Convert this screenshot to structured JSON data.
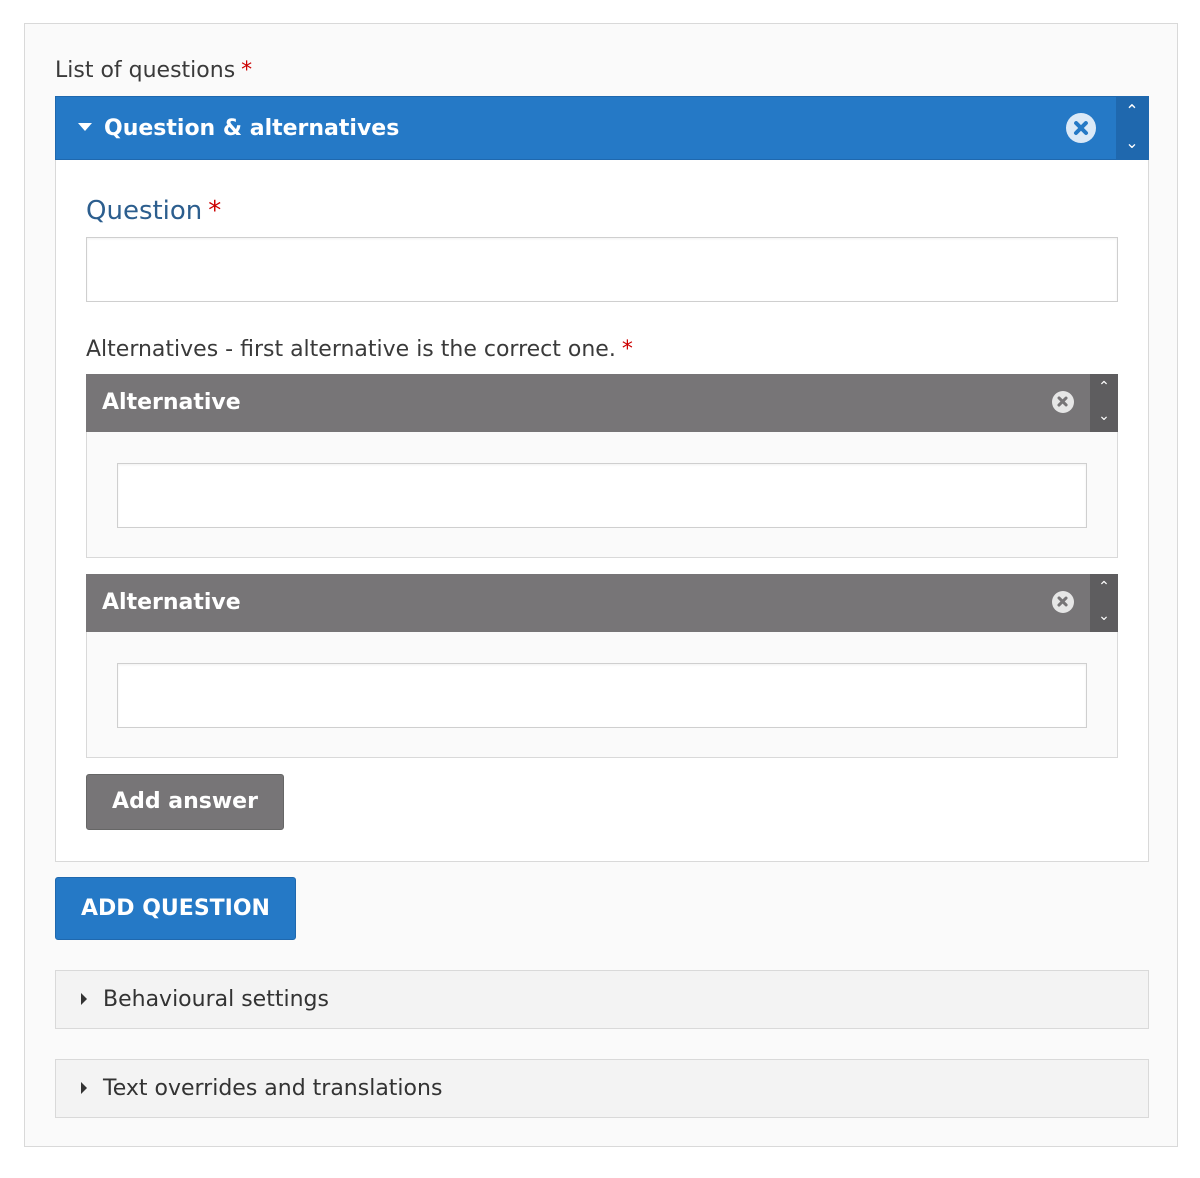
{
  "list": {
    "label": "List of questions",
    "required_mark": "*"
  },
  "group": {
    "title": "Question & alternatives",
    "question_label": "Question",
    "question_required_mark": "*",
    "question_value": "",
    "alternatives_label": "Alternatives - first alternative is the correct one.",
    "alternatives_required_mark": "*",
    "alternatives": [
      {
        "title": "Alternative",
        "value": ""
      },
      {
        "title": "Alternative",
        "value": ""
      }
    ],
    "add_answer_label": "Add answer",
    "up_glyph": "⌃",
    "down_glyph": "⌄"
  },
  "add_question_label": "ADD QUESTION",
  "sections": [
    {
      "title": "Behavioural settings"
    },
    {
      "title": "Text overrides and translations"
    }
  ],
  "colors": {
    "accent": "#2579c6",
    "alt_header": "#777577",
    "required": "#cc0000",
    "label_blue": "#2c5e8e"
  }
}
